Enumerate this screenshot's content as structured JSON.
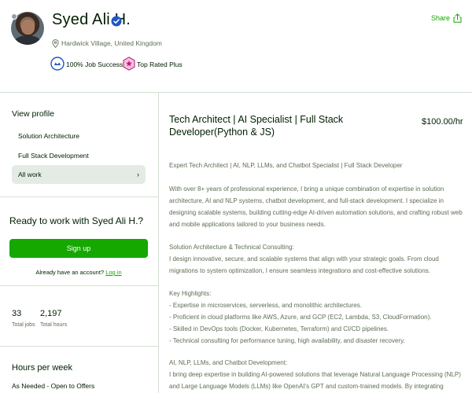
{
  "profile": {
    "name": "Syed Ali H.",
    "location": "Hardwick Village, United Kingdom",
    "badges": {
      "job_success": "100% Job Success",
      "top_rated": "Top Rated Plus"
    },
    "share_label": "Share"
  },
  "sidebar": {
    "view_profile_title": "View profile",
    "items": [
      {
        "label": "Solution Architecture"
      },
      {
        "label": "Full Stack Development"
      },
      {
        "label": "All work"
      }
    ],
    "ready_title": "Ready to work with Syed Ali H.?",
    "signup_label": "Sign up",
    "have_account_text": "Already have an account?",
    "login_label": "Log in",
    "stats": [
      {
        "value": "33",
        "label": "Total jobs"
      },
      {
        "value": "2,197",
        "label": "Total hours"
      }
    ],
    "hours_title": "Hours per week",
    "hours_value": "As Needed - Open to Offers"
  },
  "main": {
    "title": "Tech Architect | AI Specialist | Full Stack Developer(Python & JS)",
    "rate": "$100.00/hr",
    "subtitle": "Expert Tech Architect | AI, NLP, LLMs, and Chatbot Specialist | Full Stack Developer",
    "intro": "With over 8+ years of professional experience, I bring a unique combination of expertise in solution architecture, AI and NLP systems, chatbot development, and full-stack development. I specialize in designing scalable systems, building cutting-edge AI-driven automation solutions, and crafting robust web and mobile applications tailored to your business needs.",
    "sa_heading": "Solution Architecture & Technical Consulting:",
    "sa_body": "I design innovative, secure, and scalable systems that align with your strategic goals. From cloud migrations to system optimization, I ensure seamless integrations and cost-effective solutions.",
    "kh_heading": "Key Highlights:",
    "kh_items": [
      "- Expertise in microservices, serverless, and monolithic architectures.",
      "- Proficient in cloud platforms like AWS, Azure, and GCP (EC2, Lambda, S3, CloudFormation).",
      "- Skilled in DevOps tools (Docker, Kubernetes, Terraform) and CI/CD pipelines.",
      "- Technical consulting for performance tuning, high availability, and disaster recovery."
    ],
    "ai_heading": "AI, NLP, LLMs, and Chatbot Development:",
    "ai_body": "I bring deep expertise in building AI-powered solutions that leverage Natural Language Processing (NLP) and Large Language Models (LLMs) like OpenAI's GPT and custom-trained models. By integrating advanced AI"
  },
  "colors": {
    "brand_green": "#14a800",
    "text_dark": "#001e00",
    "text_muted": "#5e6d55",
    "verified_blue": "#1f57c3",
    "top_rated_pink": "#c0157a"
  }
}
